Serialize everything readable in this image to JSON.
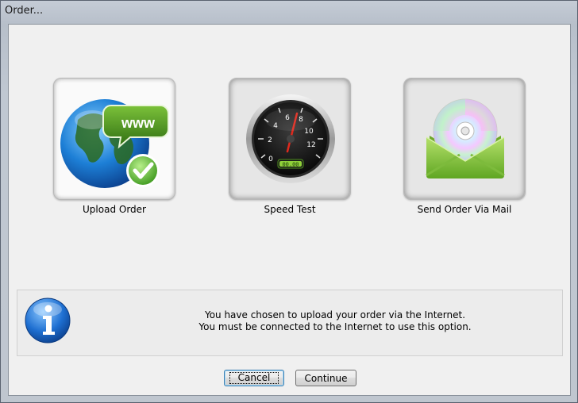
{
  "window": {
    "title": "Order..."
  },
  "options": [
    {
      "label": "Upload Order",
      "icon": "globe-www-icon",
      "selected": true
    },
    {
      "label": "Speed Test",
      "icon": "speedometer-icon",
      "gauge_readout": "00.00",
      "gauge_ticks": [
        "0",
        "2",
        "4",
        "6",
        "8",
        "10",
        "12"
      ],
      "selected": false
    },
    {
      "label": "Send Order Via Mail",
      "icon": "mail-cd-icon",
      "selected": false
    }
  ],
  "globe_badge_text": "www",
  "info": {
    "icon": "info-icon",
    "line1": "You have chosen to upload your order via the Internet.",
    "line2": "You must be connected to the Internet to use this option."
  },
  "buttons": {
    "cancel": "Cancel",
    "continue": "Continue"
  },
  "colors": {
    "info_blue": "#1e6fd1",
    "check_green": "#5bb536",
    "speech_green": "#4d8f1e",
    "envelope_green": "#8cc63f"
  }
}
